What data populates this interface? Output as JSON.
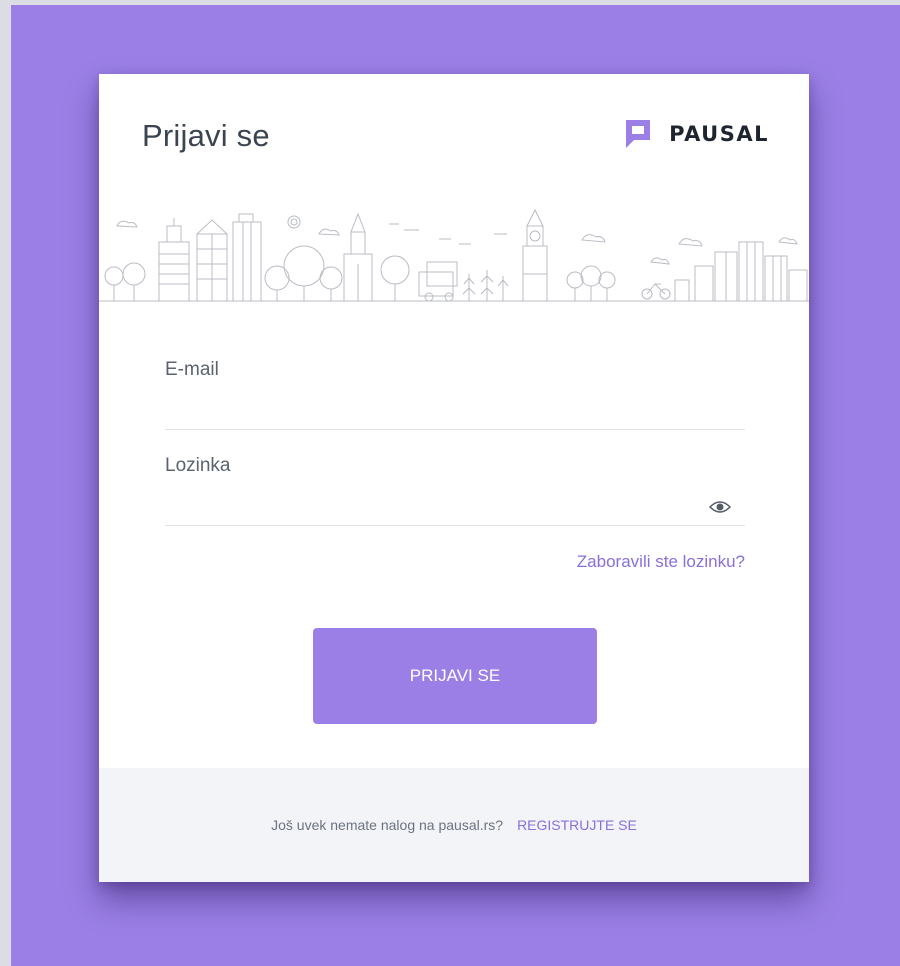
{
  "login": {
    "title": "Prijavi se",
    "brand": "PAUSAL",
    "email_label": "E-mail",
    "email_value": "",
    "password_label": "Lozinka",
    "password_value": "",
    "forgot_link": "Zaboravili ste lozinku?",
    "submit_label": "PRIJAVI SE"
  },
  "footer": {
    "prompt": "Još uvek nemate nalog na pausal.rs?",
    "register_link": "REGISTRUJTE SE"
  },
  "colors": {
    "accent": "#9b7fe6",
    "link": "#8a6fd9",
    "background": "#9b7fe6"
  },
  "icons": {
    "logo": "pausal-logo-icon",
    "password_toggle": "eye-icon"
  }
}
